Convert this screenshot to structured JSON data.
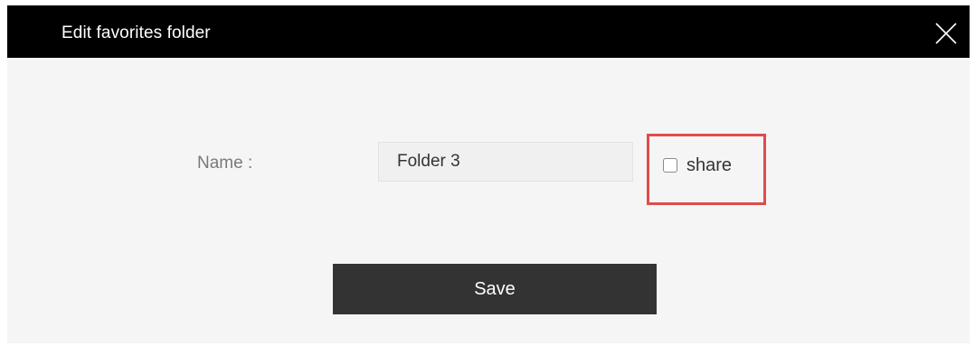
{
  "dialog": {
    "title": "Edit favorites folder",
    "close_icon": "close-icon"
  },
  "form": {
    "name_label": "Name :",
    "name_value": "Folder 3",
    "share_label": "share",
    "share_checked": false
  },
  "actions": {
    "save_label": "Save"
  },
  "colors": {
    "titlebar": "#000000",
    "dialog_bg": "#f5f5f5",
    "highlight": "#e04b4b",
    "button_bg": "#333333"
  }
}
